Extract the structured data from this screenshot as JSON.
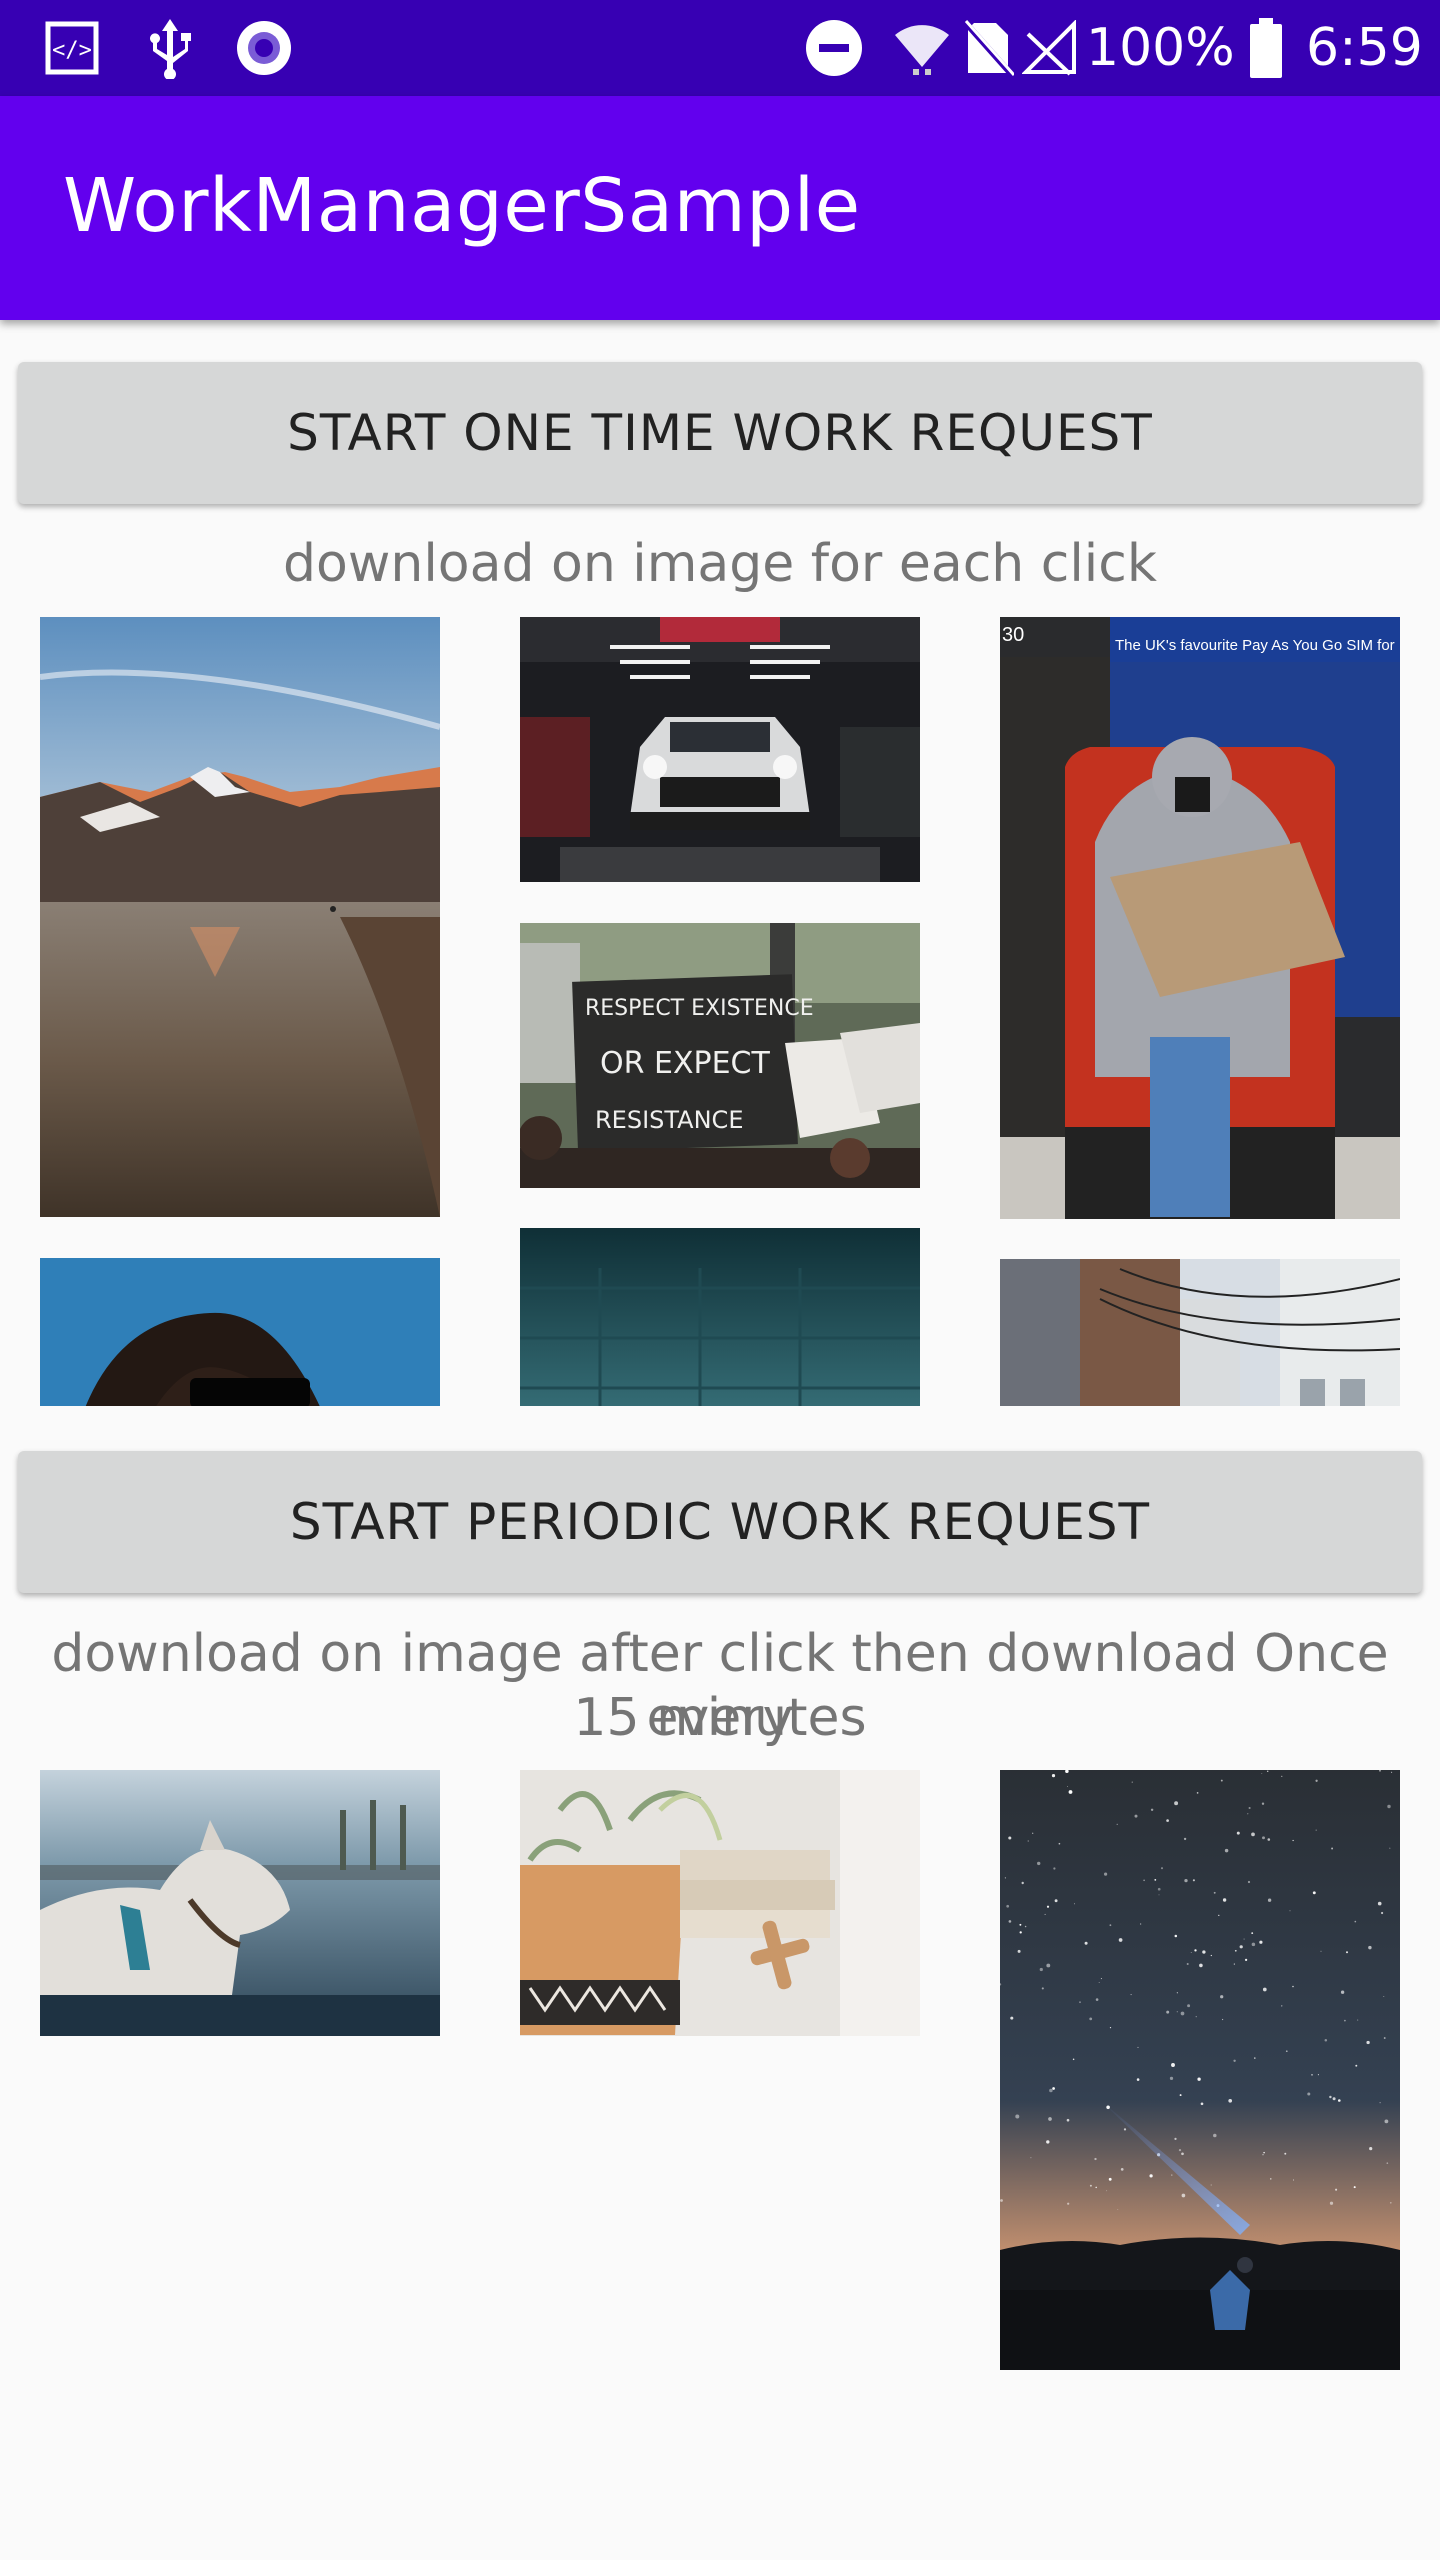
{
  "status_bar": {
    "battery_percent": "100%",
    "time": "6:59",
    "icons": [
      "code-icon",
      "usb-icon",
      "record-icon",
      "do-not-disturb-icon",
      "wifi-icon",
      "no-sim-icon",
      "signal-icon",
      "battery-icon"
    ]
  },
  "app_bar": {
    "title": "WorkManagerSample"
  },
  "one_time": {
    "button_label": "START ONE TIME WORK REQUEST",
    "caption": "download on image for each click"
  },
  "periodic": {
    "button_label": "START PERIODIC WORK REQUEST",
    "caption_line1": "download on image after click then download Once every",
    "caption_line2": "15 minutes"
  },
  "photos": {
    "post_sign_text": "The UK's favourite Pay As You Go SIM for",
    "post_box_number": "30",
    "protest_sign_line1": "RESPECT EXISTENCE",
    "protest_sign_line2": "OR EXPECT",
    "protest_sign_line3": "RESISTANCE"
  },
  "colors": {
    "status_bar": "#3700b3",
    "app_bar": "#6200ee",
    "button": "#d6d7d7",
    "caption_text": "#757575",
    "background": "#fafafa"
  }
}
